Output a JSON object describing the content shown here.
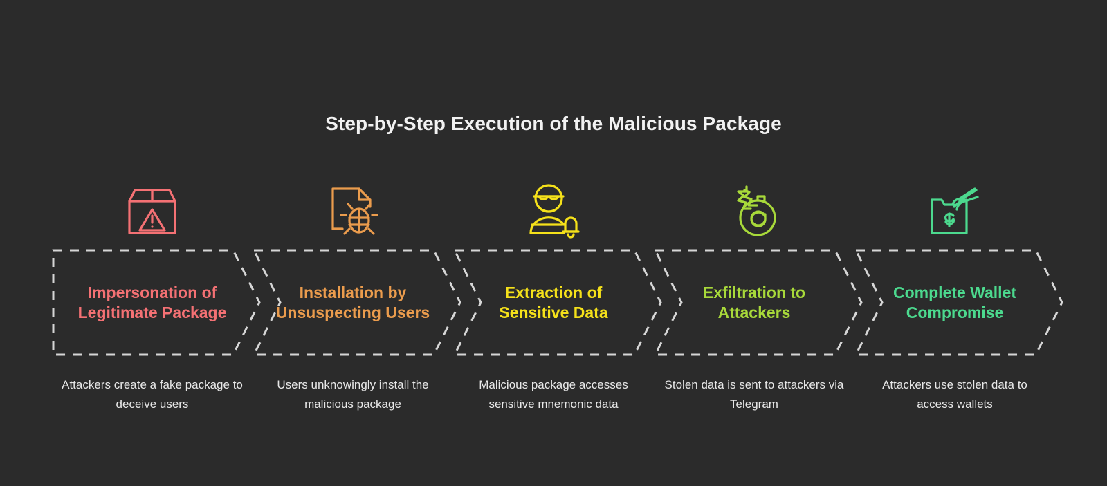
{
  "theme": {
    "background": "#2b2b2b",
    "title_color": "#f2f2f2",
    "caption_color": "#e8e8e8",
    "banner_border_color": "#d6d6d6"
  },
  "title": "Step-by-Step Execution of the Malicious Package",
  "steps": [
    {
      "label": "Impersonation of Legitimate Package",
      "caption": "Attackers create a fake package to deceive users",
      "color": "#f47174",
      "icon": "package-warning-icon"
    },
    {
      "label": "Installation by Unsuspecting Users",
      "caption": "Users unknowingly install the malicious package",
      "color": "#eb9c4d",
      "icon": "file-bug-icon"
    },
    {
      "label": "Extraction of Sensitive Data",
      "caption": "Malicious package accesses sensitive mnemonic data",
      "color": "#f5e11a",
      "icon": "spy-alert-icon"
    },
    {
      "label": "Exfiltration to Attackers",
      "caption": "Stolen data is sent to attackers via Telegram",
      "color": "#a8d93a",
      "icon": "bomb-email-icon"
    },
    {
      "label": "Complete Wallet Compromise",
      "caption": "Attackers use stolen data to access wallets",
      "color": "#4cd98e",
      "icon": "wallet-grab-icon"
    }
  ]
}
